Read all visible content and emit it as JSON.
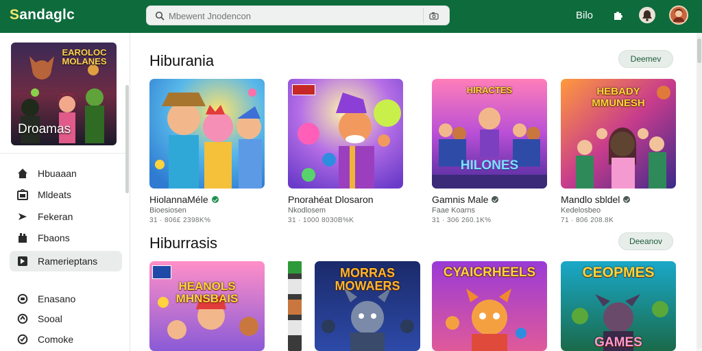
{
  "header": {
    "brand_first": "S",
    "brand_rest": "andaglc",
    "search_placeholder": "Mbewent Jnodencon",
    "top_link": "Bilo",
    "icons": [
      "search-icon",
      "camera-icon",
      "puzzle-icon",
      "notification-icon",
      "profile-avatar"
    ]
  },
  "sidebar": {
    "featured_header": "EAROLOC MOLANES",
    "featured_caption": "Droamas",
    "items": [
      {
        "label": "Hbuaaan",
        "icon": "home-icon",
        "active": false
      },
      {
        "label": "Mldeats",
        "icon": "media-icon",
        "active": false
      },
      {
        "label": "Fekeran",
        "icon": "send-icon",
        "active": false
      },
      {
        "label": "Fbaons",
        "icon": "library-icon",
        "active": false
      },
      {
        "label": "Ramerieptans",
        "icon": "explore-icon",
        "active": true
      }
    ],
    "items2": [
      {
        "label": "Enasano",
        "icon": "chat-icon"
      },
      {
        "label": "Sooal",
        "icon": "social-icon"
      },
      {
        "label": "Comoke",
        "icon": "check-icon"
      }
    ]
  },
  "sections": [
    {
      "title": "Hiburania",
      "more": "Deemev",
      "cards": [
        {
          "name": "HiolannaMéle",
          "sub": "Bioesiosen",
          "meta": "31 · 806£ 2398K%",
          "thumb_title": "",
          "verified": true
        },
        {
          "name": "Pnorahéat Dlosaron",
          "sub": "Nkodlosem",
          "meta": "31 · 1000 8030B%K",
          "thumb_title": "",
          "verified": false
        },
        {
          "name": "Gamnis Male",
          "sub": "Faae Koarns",
          "meta": "31 · 306 260.1K%",
          "thumb_title": "HIRACTES HILONES",
          "verified": true
        },
        {
          "name": "Mandlo sbldel",
          "sub": "Kedelosbeo",
          "meta": "71 · 806 208.8K",
          "thumb_title": "HEBADY MMUNESH",
          "verified": true
        }
      ]
    },
    {
      "title": "Hiburrasis",
      "more": "Deeanov",
      "cards": [
        {
          "thumb_title": "HEANOLS MHNSBAIS"
        },
        {
          "thumb_title": "MORRAS MOWAERS"
        },
        {
          "thumb_title": "CYAICRHEELS"
        },
        {
          "thumb_title": "CEOPMES GAMES"
        }
      ]
    }
  ],
  "colors": {
    "topbar": "#0d6b3c",
    "accent": "#1f8f50",
    "active_nav": "#e9ecea"
  }
}
